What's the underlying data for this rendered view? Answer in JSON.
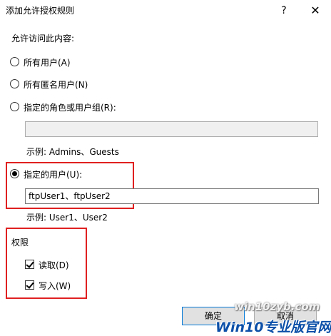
{
  "window": {
    "title": "添加允许授权规则",
    "help_glyph": "?",
    "close_glyph": "✕"
  },
  "access": {
    "heading": "允许访问此内容:",
    "options": [
      {
        "label": "所有用户(A)",
        "selected": false
      },
      {
        "label": "所有匿名用户(N)",
        "selected": false
      },
      {
        "label": "指定的角色或用户组(R):",
        "selected": false
      },
      {
        "label": "指定的用户(U):",
        "selected": true
      }
    ],
    "roles_value": "",
    "roles_example": "示例: Admins、Guests",
    "users_value": "ftpUser1、ftpUser2",
    "users_example": "示例: User1、User2"
  },
  "permissions": {
    "heading": "权限",
    "read_label": "读取(D)",
    "read_checked": true,
    "write_label": "写入(W)",
    "write_checked": true
  },
  "buttons": {
    "ok_label": "确定",
    "cancel_label": "取消"
  },
  "watermark": {
    "site": "win10zyb.com",
    "brand": "Win10专业版官网"
  },
  "colors": {
    "highlight_border": "#e02020",
    "accent": "#0078d7"
  }
}
